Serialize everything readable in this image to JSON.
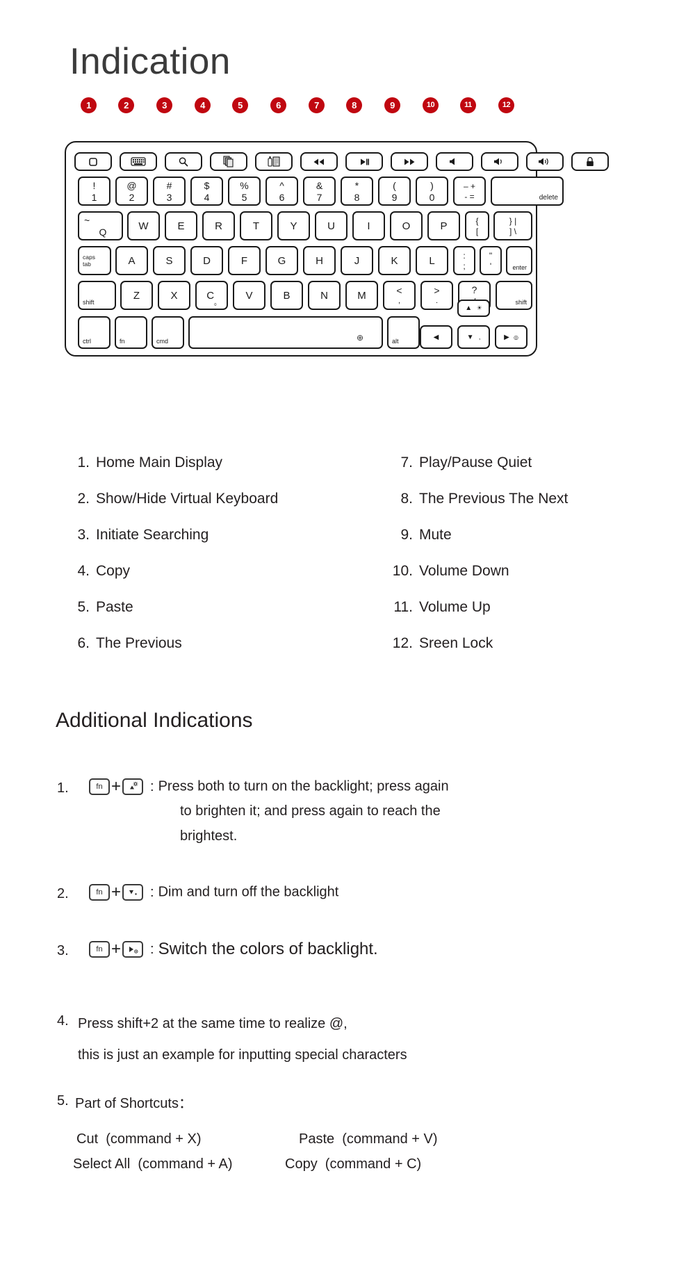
{
  "document": {
    "title": "Indication",
    "subtitle": "Additional Indications"
  },
  "badges": [
    {
      "n": "1"
    },
    {
      "n": "2"
    },
    {
      "n": "3"
    },
    {
      "n": "4"
    },
    {
      "n": "5"
    },
    {
      "n": "6"
    },
    {
      "n": "7"
    },
    {
      "n": "8"
    },
    {
      "n": "9"
    },
    {
      "n": "10"
    },
    {
      "n": "11"
    },
    {
      "n": "12"
    }
  ],
  "keyboard": {
    "function_row": [
      {
        "icon": "home-display-icon",
        "label": ""
      },
      {
        "icon": "virtual-keyboard-icon",
        "label": ""
      },
      {
        "icon": "search-icon",
        "label": ""
      },
      {
        "icon": "copy-icon",
        "label": ""
      },
      {
        "icon": "paste-icon",
        "label": ""
      },
      {
        "icon": "rewind-icon",
        "label": "◀◀"
      },
      {
        "icon": "play-pause-icon",
        "label": "▶❙"
      },
      {
        "icon": "fast-forward-icon",
        "label": "▶▶"
      },
      {
        "icon": "mute-icon",
        "label": "◀"
      },
      {
        "icon": "volume-down-icon",
        "label": "◀)"
      },
      {
        "icon": "volume-up-icon",
        "label": "◀))"
      },
      {
        "icon": "screen-lock-icon",
        "label": ""
      }
    ],
    "number_row": [
      {
        "top": "!",
        "bottom": "1"
      },
      {
        "top": "@",
        "bottom": "2"
      },
      {
        "top": "#",
        "bottom": "3"
      },
      {
        "top": "$",
        "bottom": "4"
      },
      {
        "top": "%",
        "bottom": "5"
      },
      {
        "top": "^",
        "bottom": "6"
      },
      {
        "top": "&",
        "bottom": "7"
      },
      {
        "top": "*",
        "bottom": "8"
      },
      {
        "top": "(",
        "bottom": "9"
      },
      {
        "top": ")",
        "bottom": "0"
      },
      {
        "top": "–  +",
        "bottom": "-   ="
      },
      {
        "top": "",
        "bottom": "delete"
      }
    ],
    "row_q": [
      {
        "top": "~",
        "bottom": "Q"
      },
      {
        "main": "W"
      },
      {
        "main": "E"
      },
      {
        "main": "R"
      },
      {
        "main": "T"
      },
      {
        "main": "Y"
      },
      {
        "main": "U"
      },
      {
        "main": "I"
      },
      {
        "main": "O"
      },
      {
        "main": "P"
      },
      {
        "top": "{",
        "bottom": "["
      },
      {
        "top": "}   |",
        "bottom": "]   \\"
      }
    ],
    "row_a": [
      {
        "top": "caps",
        "bottom": "tab"
      },
      {
        "main": "A"
      },
      {
        "main": "S"
      },
      {
        "main": "D"
      },
      {
        "main": "F"
      },
      {
        "main": "G"
      },
      {
        "main": "H"
      },
      {
        "main": "J"
      },
      {
        "main": "K"
      },
      {
        "main": "L"
      },
      {
        "top": ":",
        "bottom": ";"
      },
      {
        "top": "\"",
        "bottom": "'"
      },
      {
        "main": "enter"
      }
    ],
    "row_z": [
      {
        "main": "shift"
      },
      {
        "main": "Z"
      },
      {
        "main": "X"
      },
      {
        "main": "C",
        "sub": "₀"
      },
      {
        "main": "V"
      },
      {
        "main": "B"
      },
      {
        "main": "N"
      },
      {
        "main": "M"
      },
      {
        "top": "<",
        "bottom": ","
      },
      {
        "top": ">",
        "bottom": "."
      },
      {
        "top": "?",
        "bottom": "/"
      },
      {
        "main": "shift"
      }
    ],
    "bottom_row": [
      {
        "main": "ctrl"
      },
      {
        "main": "fn"
      },
      {
        "main": "cmd"
      },
      {
        "main": "space",
        "globe": "⊕"
      },
      {
        "main": "alt"
      }
    ],
    "arrows": {
      "up": "▲",
      "up_badge": "☀",
      "left": "◀",
      "down": "▼",
      "down_badge": ",",
      "right": "▶",
      "right_badge": "◎"
    }
  },
  "indication_list": {
    "left": [
      {
        "num": "1.",
        "text": "Home Main Display"
      },
      {
        "num": "2.",
        "text": "Show/Hide Virtual Keyboard"
      },
      {
        "num": "3.",
        "text": "Initiate Searching"
      },
      {
        "num": "4.",
        "text": "Copy"
      },
      {
        "num": "5.",
        "text": "Paste"
      },
      {
        "num": "6.",
        "text": "The Previous"
      }
    ],
    "right": [
      {
        "num": "7.",
        "text": "Play/Pause Quiet"
      },
      {
        "num": "8.",
        "text": "The Previous The Next"
      },
      {
        "num": "9.",
        "text": "Mute"
      },
      {
        "num": "10.",
        "text": "Volume Down"
      },
      {
        "num": "11.",
        "text": "Volume Up"
      },
      {
        "num": "12.",
        "text": "Sreen Lock"
      }
    ]
  },
  "additional": {
    "item1": {
      "num": "1.",
      "key_fn": "fn",
      "plus": "+",
      "colon": ":",
      "line1": "Press both to turn on the backlight; press again",
      "line2": "to brighten it; and press again to reach the",
      "line3": "brightest."
    },
    "item2": {
      "num": "2.",
      "key_fn": "fn",
      "plus": "+",
      "colon": ":",
      "text": "Dim and turn off the backlight"
    },
    "item3": {
      "num": "3.",
      "key_fn": "fn",
      "plus": "+",
      "colon": ":",
      "text": "Switch the colors of backlight."
    },
    "item4": {
      "num": "4.",
      "line1": "Press shift+2 at the same time to realize @,",
      "line2": "this is just an example for inputting special characters"
    },
    "item5": {
      "num": "5.",
      "heading": "Part of Shortcuts：",
      "row1_left": "Cut  (command + X)",
      "row1_right": "Paste  (command + V)",
      "row2_left": "Select All  (command + A)",
      "row2_right": "Copy  (command + C)"
    }
  },
  "colors": {
    "badge_red": "#c00710",
    "ink": "#231f20",
    "key_border": "#1a1a1a"
  }
}
